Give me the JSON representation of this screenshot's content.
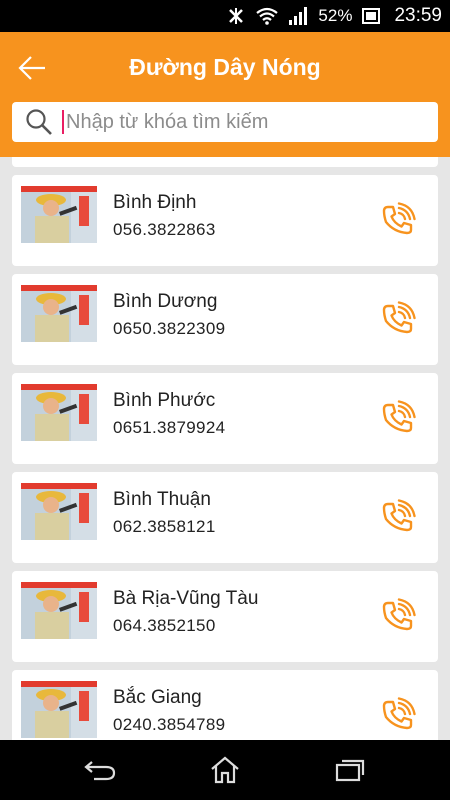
{
  "status_bar": {
    "battery_percent": "52%",
    "time": "23:59",
    "icons": [
      "nfc-off-icon",
      "wifi-icon",
      "signal-icon",
      "battery-icon"
    ]
  },
  "header": {
    "title": "Đường Dây Nóng",
    "back_icon": "arrow-left-icon",
    "accent_color": "#f7931e"
  },
  "search": {
    "placeholder": "Nhập từ khóa tìm kiếm",
    "value": ""
  },
  "contacts": [
    {
      "name": "Bình Định",
      "phone": "056.3822863"
    },
    {
      "name": "Bình Dương",
      "phone": "0650.3822309"
    },
    {
      "name": "Bình Phước",
      "phone": "0651.3879924"
    },
    {
      "name": "Bình Thuận",
      "phone": "062.3858121"
    },
    {
      "name": "Bà Rịa-Vũng Tàu",
      "phone": "064.3852150"
    },
    {
      "name": "Bắc Giang",
      "phone": "0240.3854789"
    }
  ],
  "nav_bar": {
    "buttons": [
      "back-nav-icon",
      "home-nav-icon",
      "recent-apps-icon"
    ]
  }
}
